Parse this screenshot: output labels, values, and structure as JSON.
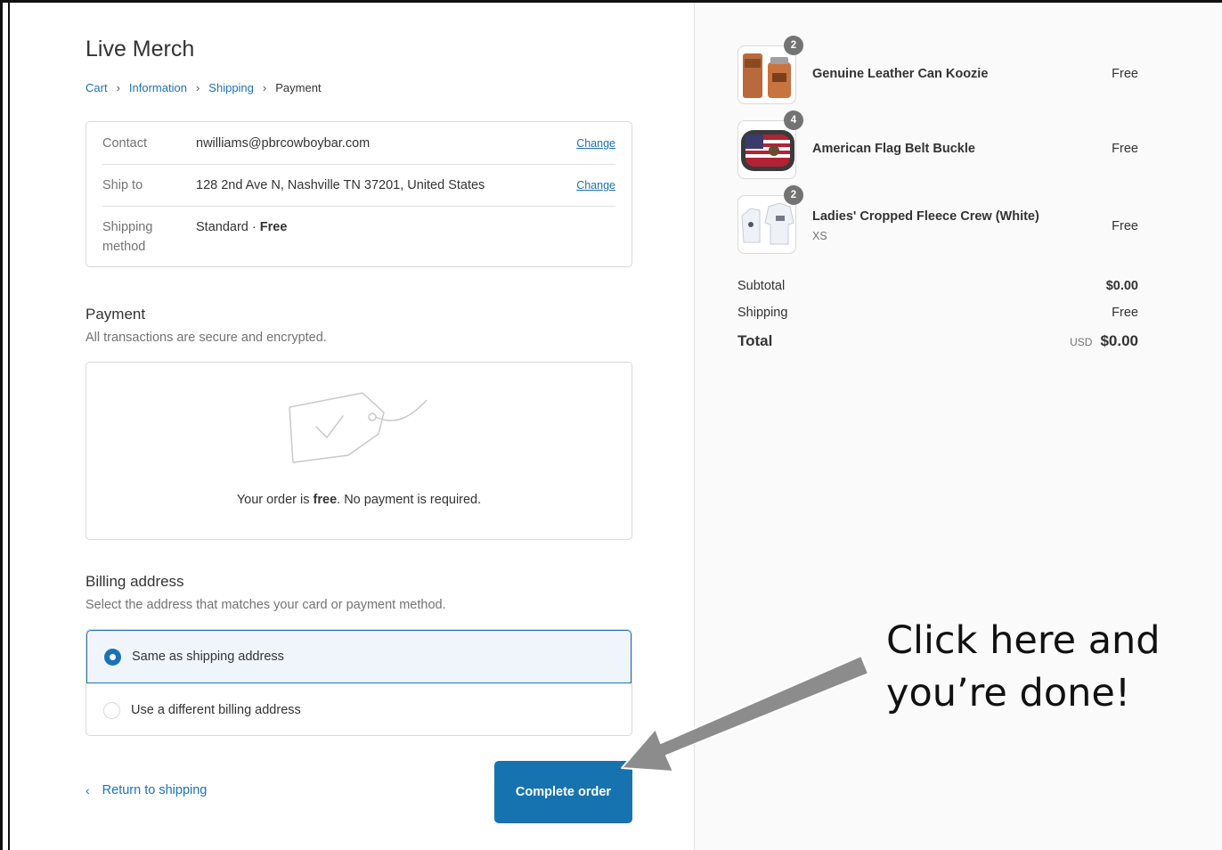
{
  "store": {
    "title": "Live Merch"
  },
  "breadcrumb": [
    {
      "label": "Cart"
    },
    {
      "label": "Information"
    },
    {
      "label": "Shipping"
    },
    {
      "label": "Payment"
    }
  ],
  "review": {
    "contact_label": "Contact",
    "contact_value": "nwilliams@pbrcowboybar.com",
    "ship_label": "Ship to",
    "ship_value": "128 2nd Ave N, Nashville TN 37201, United States",
    "change_label": "Change",
    "method_label_1": "Shipping",
    "method_label_2": "method",
    "method_value": "Standard",
    "method_sep": " · ",
    "method_price": "Free"
  },
  "payment": {
    "title": "Payment",
    "subtitle": "All transactions are secure and encrypted.",
    "msg_pre": "Your order is ",
    "msg_bold": "free",
    "msg_post": ". No payment is required."
  },
  "billing": {
    "title": "Billing address",
    "subtitle": "Select the address that matches your card or payment method.",
    "options": [
      {
        "label": "Same as shipping address",
        "selected": true
      },
      {
        "label": "Use a different billing address",
        "selected": false
      }
    ]
  },
  "actions": {
    "return_label": "Return to shipping",
    "complete_label": "Complete order"
  },
  "summary": {
    "items": [
      {
        "name": "Genuine Leather Can Koozie",
        "qty": "2",
        "price": "Free",
        "variant": ""
      },
      {
        "name": "American Flag Belt Buckle",
        "qty": "4",
        "price": "Free",
        "variant": ""
      },
      {
        "name": "Ladies' Cropped Fleece Crew (White)",
        "qty": "2",
        "price": "Free",
        "variant": "XS"
      }
    ],
    "subtotal_label": "Subtotal",
    "subtotal_value": "$0.00",
    "shipping_label": "Shipping",
    "shipping_value": "Free",
    "total_label": "Total",
    "currency": "USD",
    "total_value": "$0.00"
  },
  "annotation": {
    "line1": "Click here and",
    "line2": "you’re done!"
  },
  "colors": {
    "accent": "#1773b0",
    "link": "#1a73b8",
    "muted": "#737373"
  }
}
